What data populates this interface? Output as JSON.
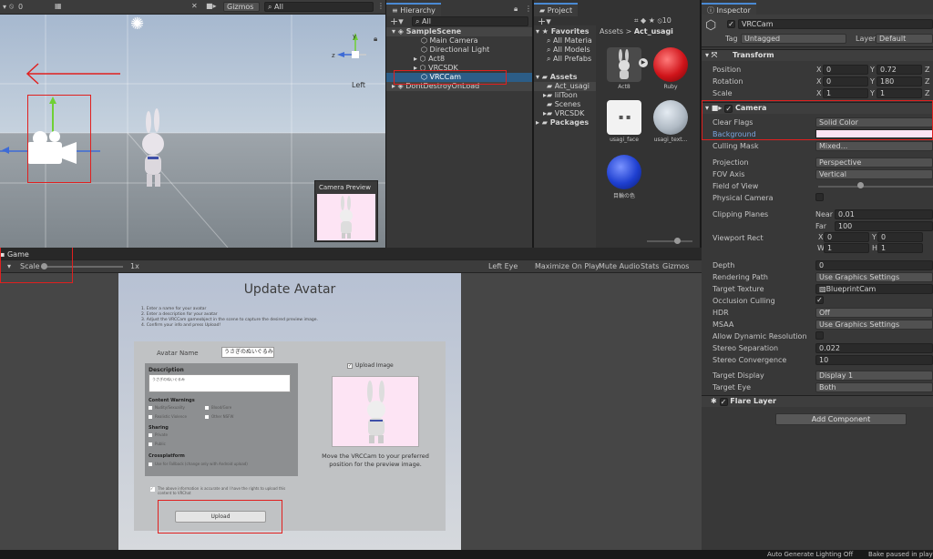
{
  "scene": {
    "toolbar": {
      "count": "0",
      "gizmos": "Gizmos",
      "search": "All"
    },
    "orientation_label": "Left",
    "camera_preview_title": "Camera Preview"
  },
  "game": {
    "tab": "Game",
    "scale_label": "Scale",
    "scale_value": "1x",
    "eye": "Left Eye",
    "maximize": "Maximize On Play",
    "mute": "Mute Audio",
    "stats": "Stats",
    "gizmos": "Gizmos"
  },
  "hierarchy": {
    "tab": "Hierarchy",
    "search": "All",
    "items": [
      "SampleScene",
      "Main Camera",
      "Directional Light",
      "Act8",
      "VRCSDK",
      "VRCCam",
      "DontDestroyOnLoad"
    ]
  },
  "project": {
    "tab": "Project",
    "count": "10",
    "favorites": "Favorites",
    "fav_items": [
      "All Materia",
      "All Models",
      "All Prefabs"
    ],
    "assets": "Assets",
    "asset_items": [
      "Act_usagi",
      "lilToon",
      "Scenes",
      "VRCSDK"
    ],
    "packages": "Packages",
    "breadcrumb_root": "Assets",
    "breadcrumb_sep": ">",
    "breadcrumb_leaf": "Act_usagi",
    "grid": [
      {
        "label": "Act8",
        "color": "#5a5a5a"
      },
      {
        "label": "Ruby",
        "color": "#d0141a"
      },
      {
        "label": "usagi_face",
        "color": "#f2f2f2"
      },
      {
        "label": "usagi_text...",
        "color": "#b0bac4"
      },
      {
        "label": "目輪の色",
        "color": "#1e3fd0"
      }
    ]
  },
  "inspector": {
    "tab": "Inspector",
    "object_name": "VRCCam",
    "tag_label": "Tag",
    "tag_value": "Untagged",
    "layer_label": "Layer",
    "layer_value": "Default",
    "transform": {
      "title": "Transform",
      "position_label": "Position",
      "pos_x": "0",
      "pos_y": "0.72",
      "pos_z": "Z",
      "rotation_label": "Rotation",
      "rot_x": "0",
      "rot_y": "180",
      "rot_z": "Z",
      "scale_label": "Scale",
      "scl_x": "1",
      "scl_y": "1",
      "scl_z": "Z"
    },
    "camera": {
      "title": "Camera",
      "clear_flags_label": "Clear Flags",
      "clear_flags": "Solid Color",
      "background_label": "Background",
      "background_color": "#fde4f4",
      "culling_mask_label": "Culling Mask",
      "culling_mask": "Mixed...",
      "projection_label": "Projection",
      "projection": "Perspective",
      "fov_axis_label": "FOV Axis",
      "fov_axis": "Vertical",
      "fov_label": "Field of View",
      "physical_label": "Physical Camera",
      "clipping_label": "Clipping Planes",
      "near_label": "Near",
      "near": "0.01",
      "far_label": "Far",
      "far": "100",
      "viewport_label": "Viewport Rect",
      "vx_label": "X",
      "vx": "0",
      "vy_label": "Y",
      "vy": "0",
      "vw_label": "W",
      "vw": "1",
      "vh_label": "H",
      "vh": "1",
      "depth_label": "Depth",
      "depth": "0",
      "rendering_path_label": "Rendering Path",
      "rendering_path": "Use Graphics Settings",
      "target_texture_label": "Target Texture",
      "target_texture": "BlueprintCam",
      "occlusion_label": "Occlusion Culling",
      "hdr_label": "HDR",
      "hdr": "Off",
      "msaa_label": "MSAA",
      "msaa": "Use Graphics Settings",
      "dyn_res_label": "Allow Dynamic Resolution",
      "stereo_sep_label": "Stereo Separation",
      "stereo_sep": "0.022",
      "stereo_conv_label": "Stereo Convergence",
      "stereo_conv": "10",
      "target_display_label": "Target Display",
      "target_display": "Display 1",
      "target_eye_label": "Target Eye",
      "target_eye": "Both"
    },
    "flare_layer": "Flare Layer",
    "add_component": "Add Component"
  },
  "upload_form": {
    "title": "Update Avatar",
    "instructions": [
      "1. Enter a name for your avatar",
      "2. Enter a description for your avatar",
      "3. Adjust the VRCCam gameobject in the scene to capture the desired preview image.",
      "4. Confirm your info and press Upload!"
    ],
    "name_label": "Avatar Name",
    "name_value": "うさぎのぬいぐるみ",
    "description_label": "Description",
    "description_value": "うさぎのぬいぐるみ",
    "content_warnings_label": "Content Warnings",
    "warnings": [
      "Nudity/Sexuality",
      "Blood/Gore",
      "Realistic Violence",
      "Other NSFW"
    ],
    "sharing_label": "Sharing",
    "sharing": [
      "Private",
      "Public"
    ],
    "crossplatform_label": "Crossplatform",
    "crossplatform_text": "Use for Fallback (change only with Android upload)",
    "upload_image_label": "Upload Image",
    "preview_caption": "Move the VRCCam to your preferred position for the preview image.",
    "rights_text": "The above information is accurate and I have the rights to upload this content to VRChat",
    "upload_button": "Upload"
  },
  "status_bar": {
    "lighting": "Auto Generate Lighting Off",
    "bake": "Bake paused in play"
  }
}
